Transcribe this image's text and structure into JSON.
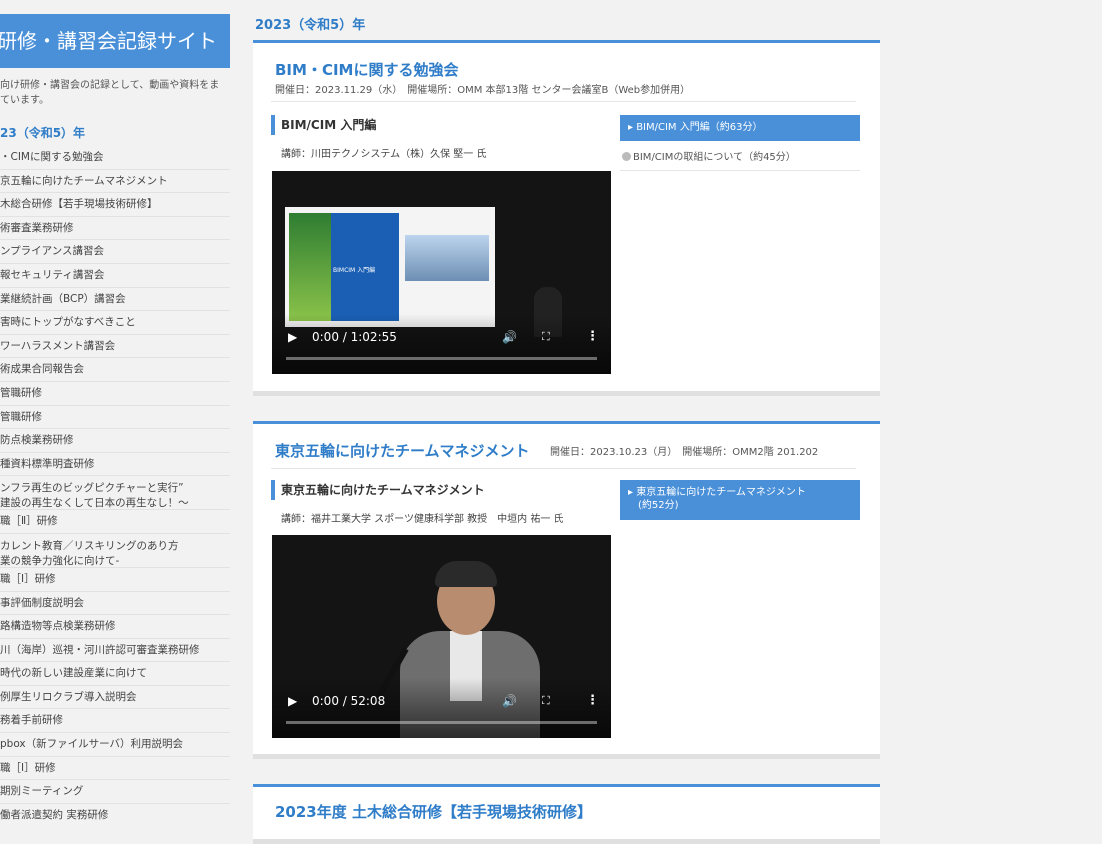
{
  "sidebar": {
    "site_title": "研修・講習会記録サイト",
    "description": "向け研修・講習会の記録として、動画や資料をま\nています。",
    "year": "23（令和5）年",
    "items": [
      "・CIMに関する勉強会",
      "京五輪に向けたチームマネジメント",
      "木総合研修【若手現場技術研修】",
      "術審査業務研修",
      "ンプライアンス講習会",
      "報セキュリティ講習会",
      "業継続計画（BCP）講習会",
      "害時にトップがなすべきこと",
      "ワーハラスメント講習会",
      "術成果合同報告会",
      "管職研修",
      "管職研修",
      "防点検業務研修",
      "種資料標準明査研修",
      "ンフラ再生のビッグピクチャーと実行”\n建設の再生なくして日本の再生なし！～",
      "職［Ⅱ］研修",
      "カレント教育／リスキリングのあり方\n業の競争力強化に向けて-",
      "職［Ⅰ］研修",
      "事評価制度説明会",
      "路構造物等点検業務研修",
      "川（海岸）巡視・河川許認可審査業務研修",
      "時代の新しい建設産業に向けて",
      "例厚生リロクラブ導入説明会",
      "務着手前研修",
      "pbox（新ファイルサーバ）利用説明会",
      "職［Ⅰ］研修",
      "期別ミーティング",
      "働者派遣契約 実務研修"
    ]
  },
  "main": {
    "year_heading": "2023（令和5）年",
    "cards": [
      {
        "title": "BIM・CIMに関する勉強会",
        "meta": "開催日：2023.11.29（水）　開催場所：OMM 本部13階 センター会議室B（Web参加併用）",
        "section": "BIM/CIM 入門編",
        "lecturer": "講師：川田テクノシステム（株）久保 堅一 氏",
        "video_time": "0:00 / 1:02:55",
        "slide_text": "BIMCIM 入門編",
        "chapters": [
          {
            "label": "▸ BIM/CIM 入門編（約63分）",
            "active": true
          },
          {
            "label": "BIM/CIMの取組について（約45分）",
            "active": false
          }
        ]
      },
      {
        "title": "東京五輪に向けたチームマネジメント",
        "meta": "開催日：2023.10.23（月）　開催場所：OMM2階 201.202",
        "section": "東京五輪に向けたチームマネジメント",
        "lecturer": "講師：福井工業大学 スポーツ健康科学部 教授　中垣内 祐一 氏",
        "video_time": "0:00 / 52:08",
        "chapters": [
          {
            "label": "▸ 東京五輪に向けたチームマネジメント\n　(約52分)",
            "active": true
          }
        ]
      },
      {
        "title": "2023年度 土木総合研修【若手現場技術研修】"
      }
    ]
  },
  "colors": {
    "accent": "#4a90d9",
    "heading": "#2f7dc8",
    "background": "#f2f2f2"
  },
  "icons": [
    "play-icon",
    "volume-icon",
    "fullscreen-icon",
    "more-icon",
    "chapter-bullet-icon"
  ]
}
